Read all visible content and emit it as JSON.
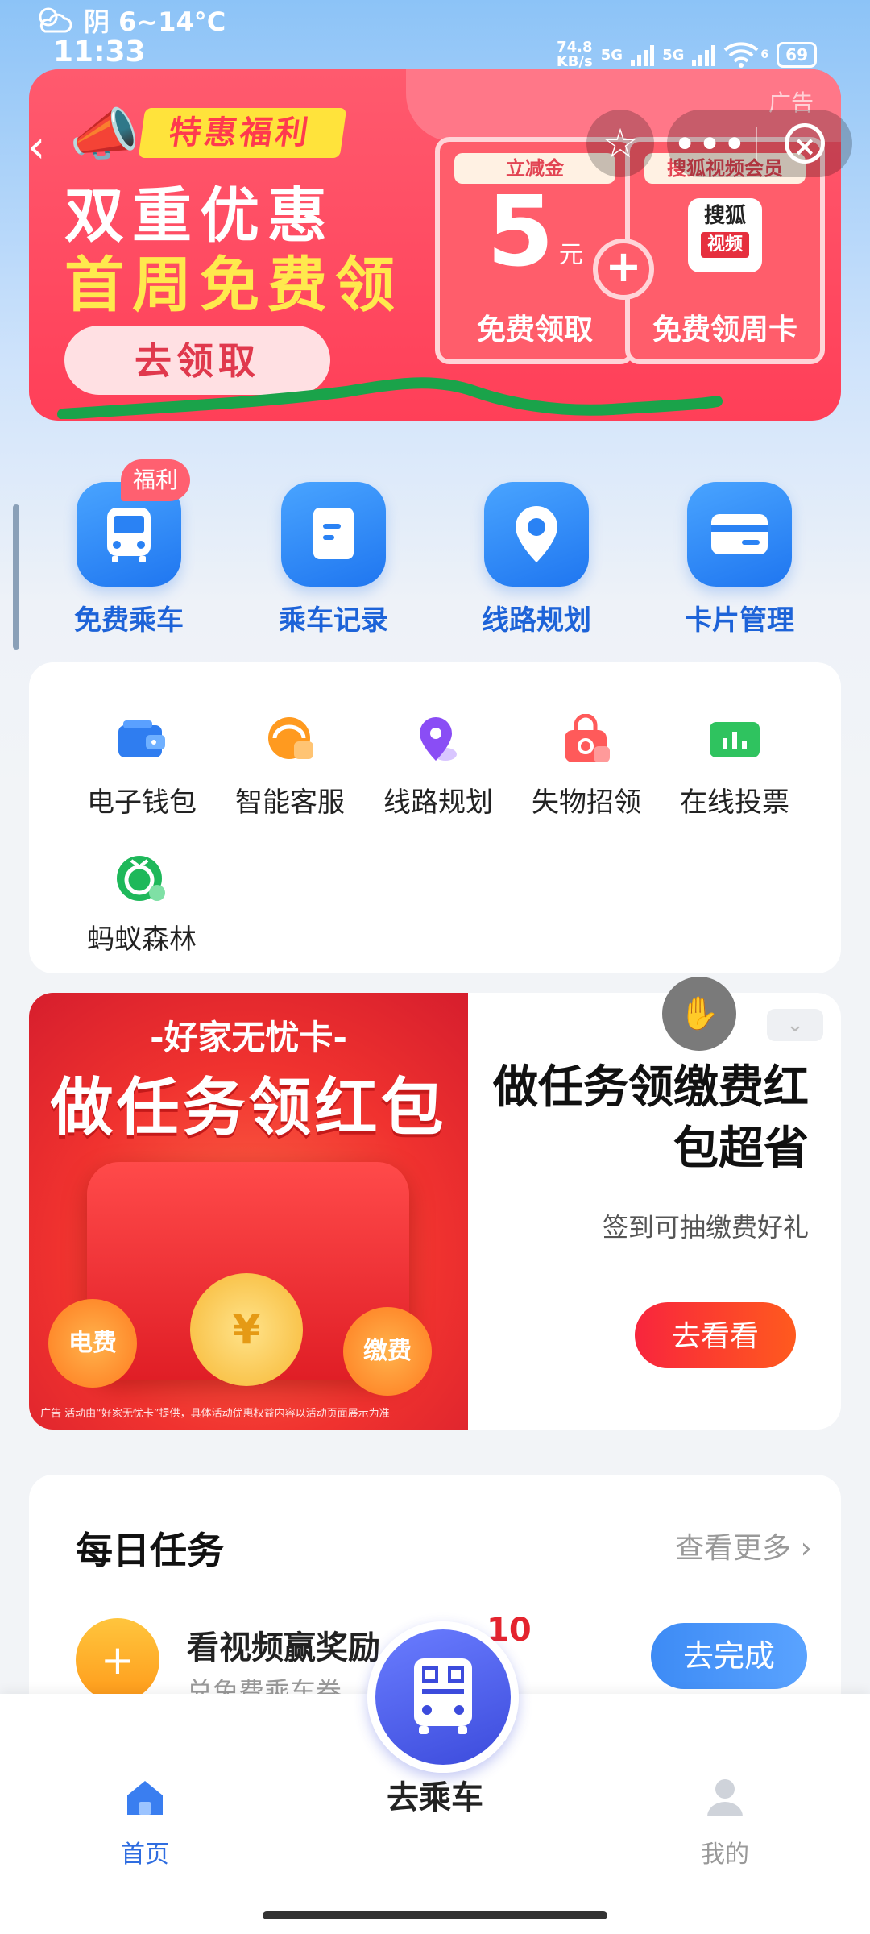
{
  "status_bar": {
    "weather": "阴 6~14°C",
    "time": "11:33",
    "net_speed": "74.8",
    "net_unit": "KB/s",
    "signal_1": "5G",
    "signal_2": "5G",
    "wifi_sub": "6",
    "battery": "69"
  },
  "ad_banner": {
    "tag": "特惠福利",
    "line1": "双重优惠",
    "line2": "首周免费领",
    "button": "去领取",
    "ad_label": "广告",
    "coupon1": {
      "top": "立减金",
      "amount": "5",
      "unit": "元",
      "bottom": "免费领取"
    },
    "coupon2": {
      "top": "搜狐视频会员",
      "logo": "搜狐",
      "logo_sub": "视频",
      "bottom": "免费领周卡"
    },
    "plus": "+",
    "scribble_color": "#1aa34a"
  },
  "capsule": {
    "more": "•••",
    "close": "×"
  },
  "quick_actions": [
    {
      "label": "免费乘车",
      "icon": "bus-icon"
    },
    {
      "label": "乘车记录",
      "icon": "record-icon"
    },
    {
      "label": "线路规划",
      "icon": "location-pin-icon"
    },
    {
      "label": "卡片管理",
      "icon": "card-icon"
    }
  ],
  "quick_badge": "福利",
  "services": [
    {
      "label": "电子钱包",
      "icon": "wallet-icon"
    },
    {
      "label": "智能客服",
      "icon": "customer-service-icon"
    },
    {
      "label": "线路规划",
      "icon": "route-pin-icon"
    },
    {
      "label": "失物招领",
      "icon": "lost-found-icon"
    },
    {
      "label": "在线投票",
      "icon": "vote-icon"
    },
    {
      "label": "蚂蚁森林",
      "icon": "ant-forest-icon"
    }
  ],
  "promo": {
    "img_subtitle": "-好家无忧卡-",
    "img_title": "做任务领红包",
    "coin": "¥",
    "bubble_left": "电费",
    "bubble_right": "缴费",
    "fine_print": "广告 活动由“好家无忧卡”提供，具体活动优惠权益内容以活动页面展示为准",
    "headline": "做任务领缴费红包超省",
    "desc": "签到可抽缴费好礼",
    "button": "去看看"
  },
  "daily_task": {
    "title": "每日任务",
    "more": "查看更多",
    "item_name": "看视频赢奖励",
    "item_points": "10",
    "item_sub": "兑免费乘车券",
    "item_button": "去完成"
  },
  "tabbar": {
    "home": "首页",
    "ride": "去乘车",
    "mine": "我的",
    "active_color": "#2f6de0",
    "inactive_color": "#999999"
  }
}
